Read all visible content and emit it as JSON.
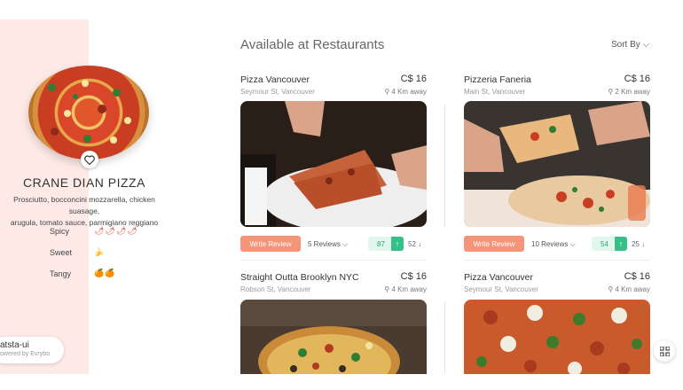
{
  "pizza": {
    "name": "CRANE DIAN PIZZA",
    "description_line1": "Prosciutto, bocconcini mozzarella, chicken suasage,",
    "description_line2": "arugula, tomato sauce, parmigiano reggiano",
    "tastes": [
      {
        "label": "Spicy",
        "icons": "🌶🌶🌶🌶",
        "level": 4
      },
      {
        "label": "Sweet",
        "icons": "🍌",
        "level": 1
      },
      {
        "label": "Tangy",
        "icons": "🍊🍊",
        "level": 2
      }
    ]
  },
  "badge": {
    "name": "atsta-ui",
    "sub": "owered by Evrybo"
  },
  "header": {
    "title": "Available at Restaurants",
    "sort_label": "Sort By ⌵"
  },
  "restaurants": [
    {
      "name": "Pizza Vancouver",
      "price": "C$ 16",
      "address": "Seymour St, Vancouver",
      "distance": "4 Km away",
      "review_button": "Write Review",
      "reviews": "5 Reviews ⌵",
      "upvotes": "87",
      "downvotes": "52"
    },
    {
      "name": "Pizzeria Faneria",
      "price": "C$ 16",
      "address": "Main St, Vancouver",
      "distance": "2 Km away",
      "review_button": "Write Review",
      "reviews": "10 Reviews ⌵",
      "upvotes": "54",
      "downvotes": "25"
    },
    {
      "name": "Straight Outta Brooklyn NYC",
      "price": "C$ 16",
      "address": "Robson St, Vancouver",
      "distance": "4 Km away"
    },
    {
      "name": "Pizza Vancouver",
      "price": "C$ 16",
      "address": "Seymour St, Vancouver",
      "distance": "4 Km away"
    }
  ],
  "icons": {
    "heart": "heart-icon",
    "pin": "location-pin-icon",
    "grid": "grid-icon",
    "up": "arrow-up-icon",
    "down": "arrow-down-icon"
  },
  "colors": {
    "panel": "#fdeae6",
    "accent": "#f4957a",
    "upvote": "#35c08a"
  }
}
